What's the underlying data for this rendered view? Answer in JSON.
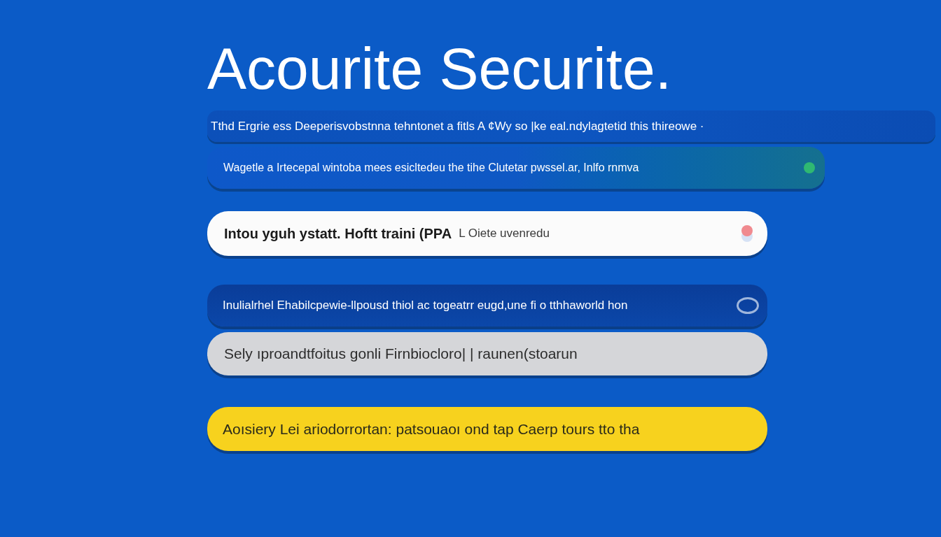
{
  "title": "Acourite Securite.",
  "rows": [
    {
      "kind": "banner",
      "text": "Tthd Ergrie ess Deeperisvobstnna tehntonet a fitls A ¢Wy so |ke eal.ndylagtetid this thireowe ·"
    },
    {
      "kind": "notice",
      "text": "Wagetle a Irtecepal wintoba mees esicltedeu the tihe Clutetar pwssel.ar, Inlfo rnmva"
    },
    {
      "kind": "input",
      "text": "Intou yguh ystatt. Hoftt traini (PPA",
      "note": "L Oiete uvenredu"
    },
    {
      "kind": "dark",
      "text": "Inulialrhel Ehabilcpewie-llpousd thiol ac togeatrr eugd,une fi o tthhaworld hon"
    },
    {
      "kind": "muted",
      "text": "Sely ıproandtfoitus gonli Firnbiocloro| | raunen(stoarun"
    },
    {
      "kind": "warning",
      "text": "Aoısiery Lei ariodorrortan: patsouaoı ond tap Caerp tours tto tha"
    }
  ]
}
